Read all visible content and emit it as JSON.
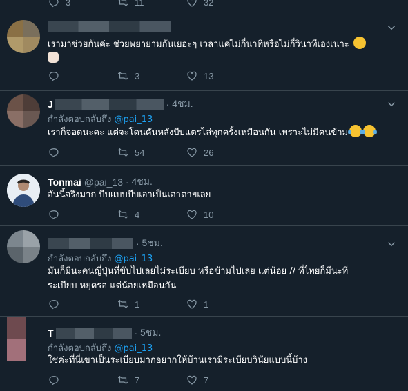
{
  "top_actions": {
    "reply_count": "3",
    "retweet_count": "11",
    "like_count": "32"
  },
  "tweets": [
    {
      "text": "เรามาช่วยกันค่ะ ช่วยพยายามกันเยอะๆ เวลาแค่ไม่กี่นาทีหรือไม่กี่วินาทีเองเนาะ",
      "reply_count": "",
      "retweet_count": "3",
      "like_count": "13"
    },
    {
      "name_initial": "J",
      "time": "4ชม.",
      "reply_label": "กำลังตอบกลับถึง",
      "reply_to": "@pai_13",
      "text": "เราก็จอดนะคะ แต่จะโดนคันหลังบีบแตรไล่ทุกครั้งเหมือนกัน เพราะไม่มีคนข้าม",
      "reply_count": "",
      "retweet_count": "54",
      "like_count": "26"
    },
    {
      "name": "Tonmai",
      "handle": "@pai_13",
      "time": "4ชม.",
      "text": "อันนี้จริงมาก บีบแบบบีบเอาเป็นเอาตายเลย",
      "reply_count": "",
      "retweet_count": "4",
      "like_count": "10"
    },
    {
      "time": "5ชม.",
      "reply_label": "กำลังตอบกลับถึง",
      "reply_to": "@pai_13",
      "text_line1": "มันก็มีนะคนญี่ปุ่นที่ขับไปเลยไม่ระเบียบ หรือข้ามไปเลย แต่น้อย // ที่ไทยก็มีนะที่",
      "text_line2": "ระเบียบ หยุดรอ แต่น้อยเหมือนกัน",
      "reply_count": "",
      "retweet_count": "1",
      "like_count": "1"
    },
    {
      "name_initial": "T",
      "time": "5ชม.",
      "reply_label": "กำลังตอบกลับถึง",
      "reply_to": "@pai_13",
      "text": "ใช่ค่ะที่นี่เขาเป็นระเบียบมากอยากให้บ้านเรามีระเบียบวินัยแบบนี้บ้าง",
      "reply_count": "",
      "retweet_count": "7",
      "like_count": "7"
    }
  ],
  "colors": {
    "background": "#15202b",
    "accent": "#1da1f2",
    "muted": "#8899a6",
    "divider": "#38444d"
  }
}
